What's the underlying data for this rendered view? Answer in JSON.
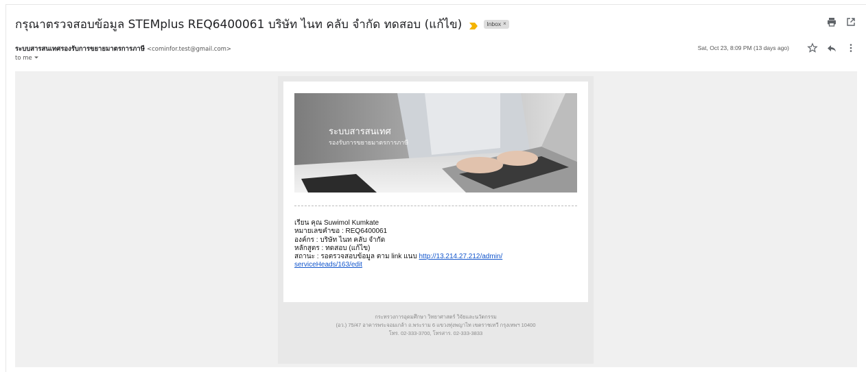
{
  "email": {
    "subject": "กรุณาตรวจสอบข้อมูล STEMplus REQ6400061 บริษัท ไนท คลับ จำกัด ทดสอบ (แก้ไข)",
    "label": "Inbox",
    "label_remove": "×",
    "sender_name": "ระบบสารสนเทศรองรับการขยายมาตรการภาษี",
    "sender_email": "<cominfor.test@gmail.com>",
    "recipient": "to me",
    "date": "Sat, Oct 23, 8:09 PM (13 days ago)"
  },
  "banner": {
    "title": "ระบบสารสนเทศ",
    "subtitle": "รองรับการขยายมาตรการภาษี"
  },
  "body": {
    "greeting": "เรียน คุณ Suwimol Kumkate",
    "request_no": "หมายเลขคำขอ : REQ6400061",
    "organization": "องค์กร : บริษัท ไนท คลับ จำกัด",
    "course": "หลักสูตร : ทดสอบ (แก้ไข)",
    "status_prefix": "สถานะ : รอตรวจสอบข้อมูล ตาม link แนบ ",
    "link_part1": "http://13.214.27.212/admin/",
    "link_part2": "serviceHeads/163/edit"
  },
  "footer": {
    "line1": "กระทรวงการอุดมศึกษา วิทยาศาสตร์ วิจัยและนวัตกรรม",
    "line2": "(อว.) 75/47 อาคารพระจอมเกล้า ถ.พระราม 6 แขวงทุ่งพญาไท เขตราชเทวี กรุงเทพฯ 10400",
    "line3": "โทร. 02-333-3700, โทรสาร. 02-333-3833"
  },
  "icons": {
    "print": "print-icon",
    "open_new": "open-in-new-window-icon",
    "star": "star-icon",
    "reply": "reply-icon",
    "more": "more-vertical-icon",
    "important": "important-marker-icon",
    "dropdown": "chevron-down-icon"
  },
  "colors": {
    "important": "#f4b400",
    "link": "#1155cc"
  }
}
